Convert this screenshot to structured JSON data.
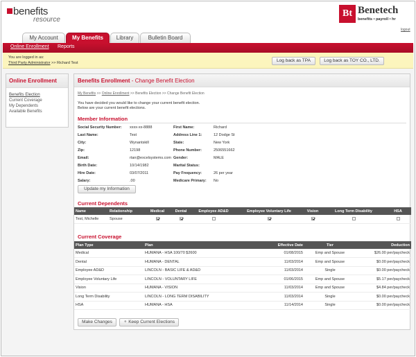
{
  "brand": {
    "left_logo_main": "benefits",
    "left_logo_sub": "resource",
    "right_logo_mark": "Bt",
    "right_logo_name": "Benetech",
    "right_logo_tag": "benefits • payroll • hr",
    "logout": "logout"
  },
  "tabs": [
    {
      "label": "My Account"
    },
    {
      "label": "My Benefits"
    },
    {
      "label": "Library"
    },
    {
      "label": "Bulletin Board"
    }
  ],
  "nav": {
    "items": [
      {
        "label": "Online Enrollment"
      },
      {
        "label": "Reports"
      }
    ]
  },
  "login": {
    "line1": "You are logged in as:",
    "line2_link": "Third Party Administrator",
    "line2_rest": " >> Richard Test",
    "btn_tpa": "Log back as TPA",
    "btn_toy": "Log back as TOY CO., LTD."
  },
  "sidebar": {
    "title": "Online Enrollment",
    "items": [
      {
        "label": "Benefits Election"
      },
      {
        "label": "Current Coverage"
      },
      {
        "label": "My Dependents"
      },
      {
        "label": "Available Benefits"
      }
    ]
  },
  "main": {
    "title": "Benefits Enrollment",
    "subtitle": " - Change Benefit Election",
    "crumbs": [
      "My Benefits",
      "Online Enrollment",
      "Benefits Election",
      "Change Benefit Election"
    ],
    "intro1": "You have decided you would like to change your current benefit election.",
    "intro2": "Below are your current benefit elections."
  },
  "member": {
    "section": "Member Information",
    "left": [
      {
        "label": "Social Security Number:",
        "value": "xxxx-xx-8888"
      },
      {
        "label": "Last Name:",
        "value": "Test"
      },
      {
        "label": "City:",
        "value": "Wynantskill"
      },
      {
        "label": "Zip:",
        "value": "12198"
      },
      {
        "label": "Email:",
        "value": "rtan@excelsystems.com"
      },
      {
        "label": "Birth Date:",
        "value": "10/14/1982"
      },
      {
        "label": "Hire Date:",
        "value": "03/07/2011"
      },
      {
        "label": "Salary:",
        "value": ".00"
      }
    ],
    "right": [
      {
        "label": "First Name:",
        "value": "Richard"
      },
      {
        "label": "Address Line 1:",
        "value": "12 Dodge St"
      },
      {
        "label": "State:",
        "value": "New York"
      },
      {
        "label": "Phone Number:",
        "value": "2506551662"
      },
      {
        "label": "Gender:",
        "value": "MALE"
      },
      {
        "label": "Marital Status:",
        "value": ""
      },
      {
        "label": "Pay Frequency:",
        "value": "26 per year"
      },
      {
        "label": "Medicare Primary:",
        "value": "No"
      }
    ],
    "update_button": "Update my Information"
  },
  "dependents": {
    "section": "Current Dependents",
    "headers": [
      "Name",
      "Relationship",
      "Medical",
      "Dental",
      "Employee AD&D",
      "Employee Voluntary Life",
      "Vision",
      "Long Term Disability",
      "HSA"
    ],
    "rows": [
      {
        "name": "Test, Michelle",
        "relationship": "Spouse",
        "checks": [
          true,
          true,
          false,
          true,
          true,
          false,
          false
        ]
      }
    ]
  },
  "coverage": {
    "section": "Current Coverage",
    "headers": [
      "Plan Type",
      "Plan",
      "Effective Date",
      "Tier",
      "Deduction"
    ],
    "rows": [
      {
        "type": "Medical",
        "plan": "HUMANA - HSA 100/70 $2600",
        "date": "01/08/2015",
        "tier": "Emp and Spouse",
        "deduction": "$26.00 per/paycheck"
      },
      {
        "type": "Dental",
        "plan": "HUMANA - DENTAL",
        "date": "11/03/2014",
        "tier": "Emp and Spouse",
        "deduction": "$0.00 per/paycheck"
      },
      {
        "type": "Employee AD&D",
        "plan": "LINCOLN - BASIC LIFE & AD&D",
        "date": "11/03/2014",
        "tier": "Single",
        "deduction": "$0.00 per/paycheck"
      },
      {
        "type": "Employee Voluntary Life",
        "plan": "LINCOLN - VOLUNTARY LIFE",
        "date": "01/06/2015",
        "tier": "Emp and Spouse",
        "deduction": "$5.17 per/paycheck"
      },
      {
        "type": "Vision",
        "plan": "HUMANA - VISION",
        "date": "11/03/2014",
        "tier": "Emp and Spouse",
        "deduction": "$4.84 per/paycheck"
      },
      {
        "type": "Long Term Disability",
        "plan": "LINCOLN - LONG TERM DISABILITY",
        "date": "11/03/2014",
        "tier": "Single",
        "deduction": "$0.00 per/paycheck"
      },
      {
        "type": "HSA",
        "plan": "HUMANA - HSA",
        "date": "11/14/2014",
        "tier": "Single",
        "deduction": "$0.00 per/paycheck"
      }
    ],
    "make_changes": "Make Changes",
    "keep_current": "Keep Current Elections"
  }
}
